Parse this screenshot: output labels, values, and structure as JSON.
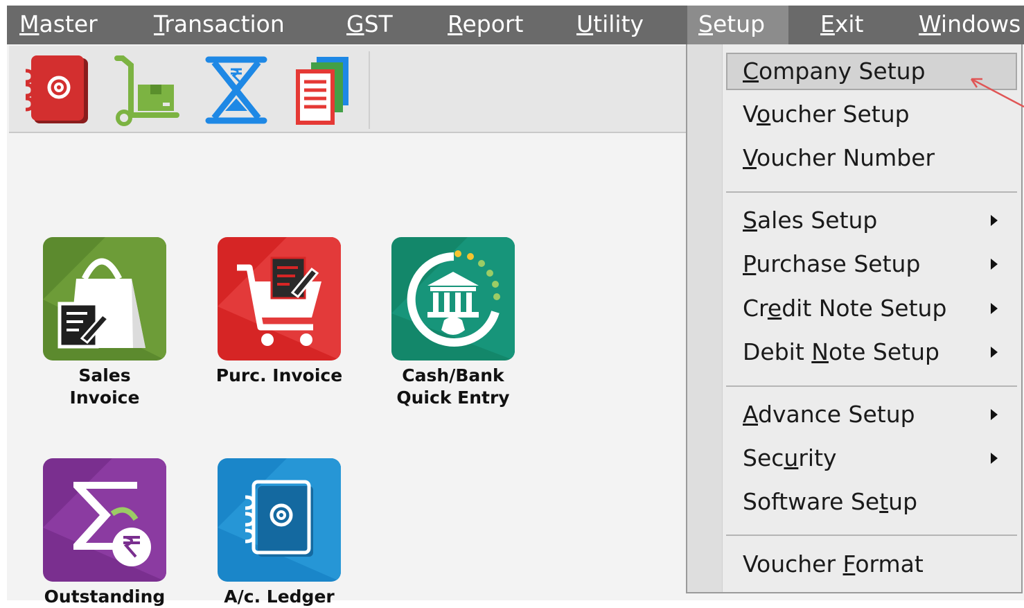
{
  "menubar": {
    "items": [
      {
        "pre": "",
        "key": "M",
        "post": "aster"
      },
      {
        "pre": "",
        "key": "T",
        "post": "ransaction"
      },
      {
        "pre": "",
        "key": "G",
        "post": "ST"
      },
      {
        "pre": "",
        "key": "R",
        "post": "eport"
      },
      {
        "pre": "",
        "key": "U",
        "post": "tility"
      },
      {
        "pre": "",
        "key": "S",
        "post": "etup"
      },
      {
        "pre": "",
        "key": "E",
        "post": "xit"
      },
      {
        "pre": "",
        "key": "W",
        "post": "indows"
      }
    ],
    "active": "Setup"
  },
  "toolbar": {
    "icons": [
      "address-book-icon",
      "hand-truck-icon",
      "rupee-hourglass-icon",
      "documents-stack-icon"
    ]
  },
  "tiles": [
    {
      "caption": "Sales\nInvoice",
      "icon": "shopping-bag-icon",
      "color": "#5c8a2e"
    },
    {
      "caption": "Purc. Invoice",
      "icon": "shopping-cart-icon",
      "color": "#d62525"
    },
    {
      "caption": "Cash/Bank\nQuick Entry",
      "icon": "bank-icon",
      "color": "#13876a"
    },
    {
      "caption": "Outstanding",
      "icon": "sigma-rupee-icon",
      "color": "#7a2f8f"
    },
    {
      "caption": "A/c. Ledger",
      "icon": "address-book-icon",
      "color": "#1a86c9"
    }
  ],
  "setup_menu": {
    "items": [
      {
        "pre": "",
        "key": "C",
        "post": "ompany Setup",
        "submenu": false
      },
      {
        "pre": "V",
        "key": "o",
        "post": "ucher Setup",
        "submenu": false
      },
      {
        "pre": "",
        "key": "V",
        "post": "oucher Number",
        "submenu": false
      },
      {
        "pre": "",
        "key": "S",
        "post": "ales Setup",
        "submenu": true
      },
      {
        "pre": "",
        "key": "P",
        "post": "urchase Setup",
        "submenu": true
      },
      {
        "pre": "Cr",
        "key": "e",
        "post": "dit Note Setup",
        "submenu": true
      },
      {
        "pre": "Debit ",
        "key": "N",
        "post": "ote Setup",
        "submenu": true
      },
      {
        "pre": "",
        "key": "A",
        "post": "dvance Setup",
        "submenu": true
      },
      {
        "pre": "Sec",
        "key": "u",
        "post": "rity",
        "submenu": true
      },
      {
        "pre": "Software Se",
        "key": "t",
        "post": "up",
        "submenu": false
      },
      {
        "pre": "Voucher ",
        "key": "F",
        "post": "ormat",
        "submenu": false
      }
    ],
    "highlighted": "Company Setup"
  },
  "colors": {
    "menubar": "#6a6a6a",
    "annotation_arrow": "#e05555"
  }
}
